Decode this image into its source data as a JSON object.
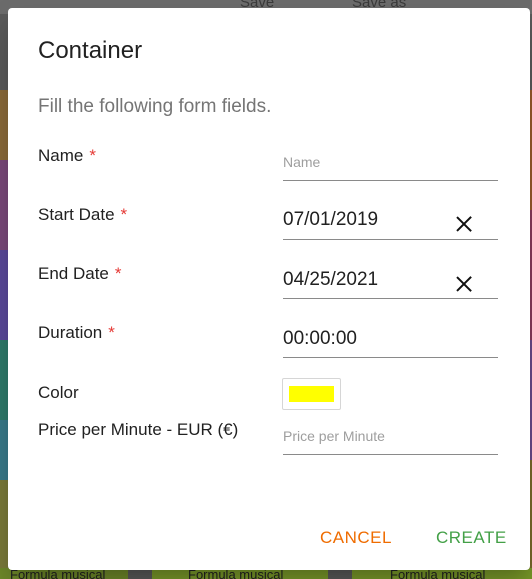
{
  "background": {
    "toolbar_items": [
      "Save",
      "Save as"
    ],
    "cell_labels": [
      "Formula musical",
      "Formula musical",
      "Formula musical"
    ],
    "strip_colors": [
      "#8a6a3a",
      "#7a4a7a",
      "#5a4a9a",
      "#2f7a6a",
      "#3a7a8a",
      "#7a7a3a",
      "#8a6a3a",
      "#6a8a2a"
    ],
    "right_strip_colors": [
      "#9a5a2a",
      "#8a3a5a",
      "#6a4a8a",
      "#7a6a2a"
    ]
  },
  "dialog": {
    "title": "Container",
    "subtitle": "Fill the following form fields.",
    "fields": {
      "name": {
        "label": "Name",
        "required_mark": "*",
        "value": "",
        "placeholder": "Name"
      },
      "start_date": {
        "label": "Start Date",
        "required_mark": "*",
        "value": "07/01/2019"
      },
      "end_date": {
        "label": "End Date",
        "required_mark": "*",
        "value": "04/25/2021"
      },
      "duration": {
        "label": "Duration",
        "required_mark": "*",
        "value": "00:00:00"
      },
      "color": {
        "label": "Color",
        "value": "#ffff00"
      },
      "price": {
        "label": "Price per Minute  - EUR (€)",
        "value": "",
        "placeholder": "Price per Minute"
      }
    },
    "actions": {
      "cancel": "CANCEL",
      "create": "CREATE"
    },
    "colors": {
      "cancel": "#ef6c00",
      "create": "#43a047",
      "required": "#e53935"
    }
  }
}
